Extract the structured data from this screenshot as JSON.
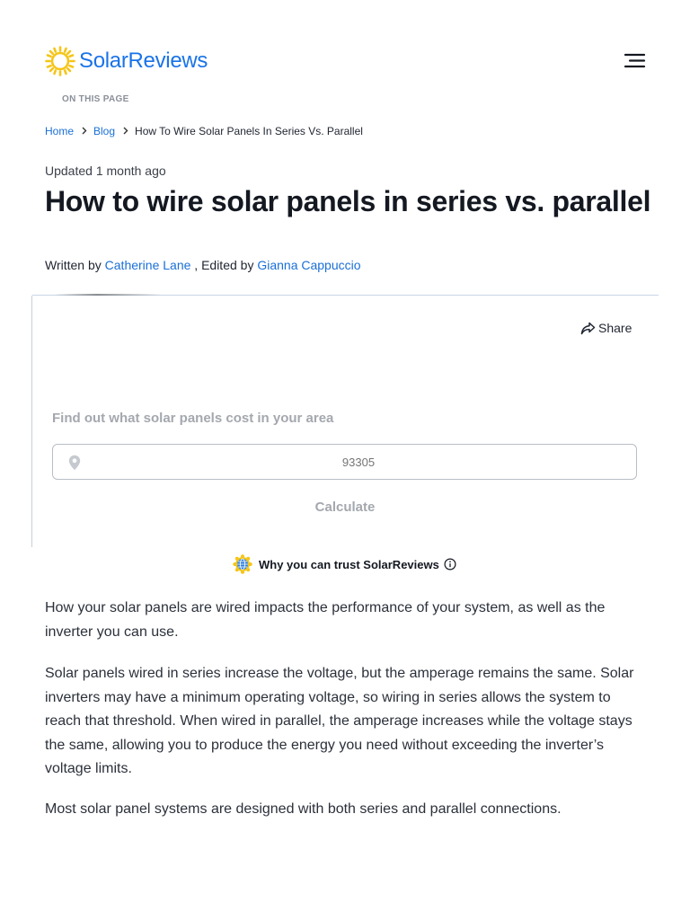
{
  "header": {
    "logo_text": "SolarReviews",
    "logo_color": "#1a73e8",
    "sun_color": "#f5c518",
    "menu_icon": "hamburger-menu-icon"
  },
  "on_this_page": "ON THIS PAGE",
  "breadcrumb": {
    "items": [
      {
        "label": "Home"
      },
      {
        "label": "Blog"
      },
      {
        "label": "How To Wire Solar Panels In Series Vs. Parallel"
      }
    ],
    "separator_icon": "chevron-right-icon"
  },
  "article": {
    "updated": "Updated 1 month ago",
    "title": "How to wire solar panels in series vs. parallel",
    "byline": {
      "written_prefix": "Written by",
      "author": "Catherine Lane",
      "edited_prefix": ", Edited by",
      "editor": "Gianna Cappuccio"
    },
    "paragraphs": [
      "How your solar panels are wired impacts the performance of your system, as well as the inverter you can use.",
      "Solar panels wired in series increase the voltage, but the amperage remains the same. Solar inverters may have a minimum operating voltage, so wiring in series allows the system to reach that threshold. When wired in parallel, the amperage increases while the voltage stays the same, allowing you to produce the energy you need without exceeding the inverter’s voltage limits.",
      "Most solar panel systems are designed with both series and parallel connections."
    ]
  },
  "share": {
    "label": "Share",
    "icon": "share-arrow-icon"
  },
  "calculator": {
    "label": "Find out what solar panels cost in your area",
    "zip_placeholder": "93305",
    "pin_icon": "location-pin-icon",
    "button_label": "Calculate"
  },
  "trust": {
    "label": "Why you can trust SolarReviews",
    "badge_icon": "trust-badge-icon",
    "info_icon": "info-icon"
  },
  "colors": {
    "link": "#1a6fd6",
    "muted": "#a4a8ae",
    "text": "#141821"
  }
}
